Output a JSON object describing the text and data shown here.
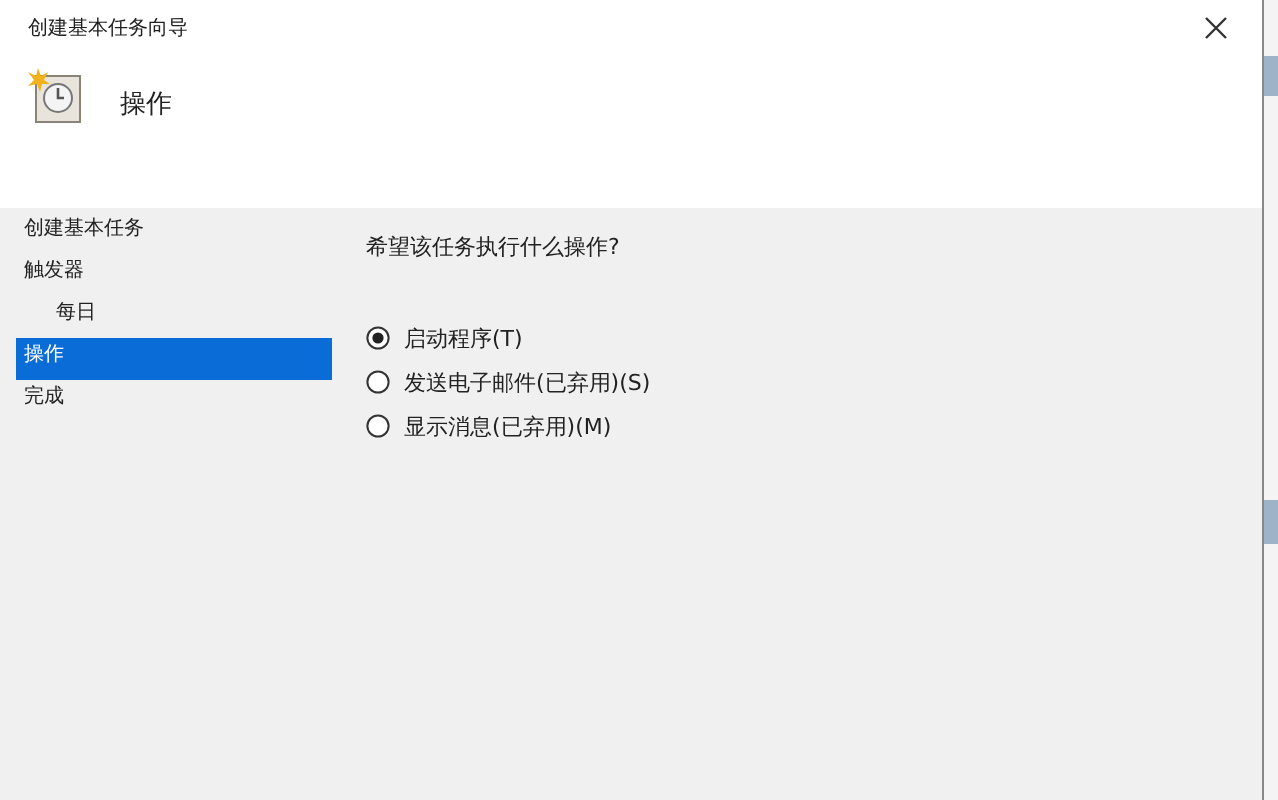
{
  "window": {
    "title": "创建基本任务向导"
  },
  "header": {
    "title": "操作"
  },
  "steps": [
    {
      "label": "创建基本任务",
      "selected": false
    },
    {
      "label": "触发器",
      "selected": false,
      "children": [
        {
          "label": "每日",
          "selected": false
        }
      ]
    },
    {
      "label": "操作",
      "selected": true
    },
    {
      "label": "完成",
      "selected": false
    }
  ],
  "question": "希望该任务执行什么操作?",
  "options": [
    {
      "label": "启动程序(T)",
      "selected": true
    },
    {
      "label": "发送电子邮件(已弃用)(S)",
      "selected": false
    },
    {
      "label": "显示消息(已弃用)(M)",
      "selected": false
    }
  ]
}
